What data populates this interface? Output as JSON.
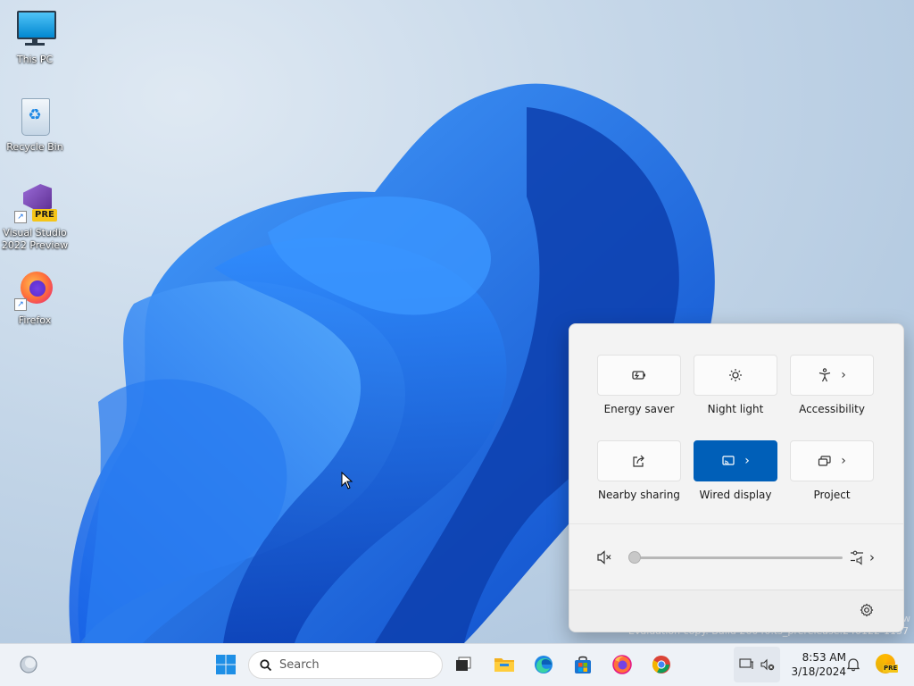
{
  "desktop": {
    "icons": [
      {
        "label": "This PC"
      },
      {
        "label": "Recycle Bin"
      },
      {
        "label": "Visual Studio 2022 Preview",
        "badge": "PRE"
      },
      {
        "label": "Firefox"
      }
    ],
    "watermark": "Evaluation copy. Build 26040.ts_prerelease.240122-1157",
    "watermark_partial": "w"
  },
  "quick_settings": {
    "tiles": [
      {
        "label": "Energy saver",
        "icon": "energy-saver-icon",
        "active": false,
        "has_chevron": false
      },
      {
        "label": "Night light",
        "icon": "night-light-icon",
        "active": false,
        "has_chevron": false
      },
      {
        "label": "Accessibility",
        "icon": "accessibility-icon",
        "active": false,
        "has_chevron": true
      },
      {
        "label": "Nearby sharing",
        "icon": "share-icon",
        "active": false,
        "has_chevron": false
      },
      {
        "label": "Wired display",
        "icon": "cast-icon",
        "active": true,
        "has_chevron": true
      },
      {
        "label": "Project",
        "icon": "project-icon",
        "active": false,
        "has_chevron": true
      }
    ],
    "volume": {
      "muted": true,
      "level": 0
    },
    "colors": {
      "accent": "#005fb8",
      "panel": "#f3f3f3"
    }
  },
  "taskbar": {
    "search_placeholder": "Search",
    "pinned": [
      "task-view",
      "file-explorer",
      "edge",
      "microsoft-store",
      "firefox",
      "chrome"
    ],
    "clock": {
      "time": "8:53 AM",
      "date": "3/18/2024"
    },
    "pre_badge": "PRE"
  }
}
